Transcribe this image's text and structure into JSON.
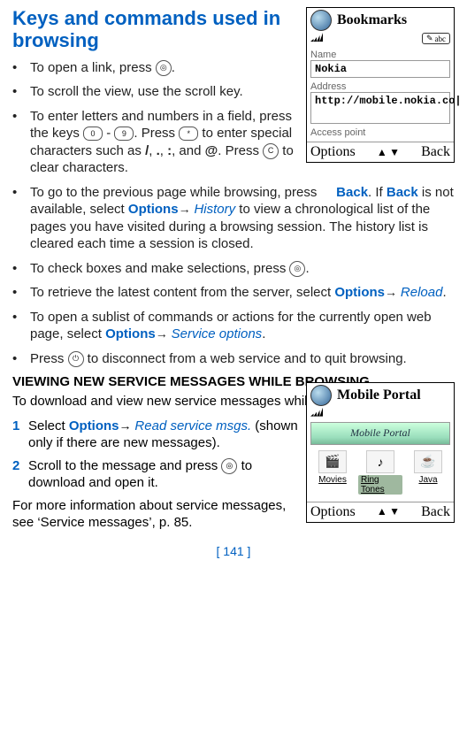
{
  "heading": "Keys and commands used in browsing",
  "bullets": [
    {
      "pre": "To open a link, press ",
      "key": "scroll",
      "post": "."
    },
    {
      "pre": "To scroll the view, use the scroll key.",
      "key": null,
      "post": ""
    },
    {
      "enter_field": true,
      "t1": "To enter letters and numbers in a field, press the keys ",
      "key0": "0",
      "dash": " - ",
      "key9": "9",
      "t2": ". Press ",
      "keystar": "*",
      "t3": " to enter special characters such as ",
      "s1": "/",
      "c1": ", ",
      "s2": ".",
      "c2": ", ",
      "s3": ":",
      "c3": ", and ",
      "s4": "@",
      "t4": ". Press ",
      "keyC": "C",
      "t5": " to clear characters."
    },
    {
      "prevpage": true,
      "t1": "To go to the previous page while browsing, press ",
      "back": "Back",
      "t2": ". If ",
      "back2": "Back",
      "t3": " is not available, select ",
      "opt": "Options",
      "arrow": "→ ",
      "hist": "History",
      "t4": " to view a chronological list of the pages you have visited during a browsing session. The history list is cleared each time a session is closed."
    },
    {
      "pre": "To check boxes and make selections, press ",
      "key": "scroll",
      "post": "."
    },
    {
      "retrieve": true,
      "t1": "To retrieve the latest content from the server, select ",
      "opt": "Options",
      "arrow": "→ ",
      "reload": "Reload",
      "t2": "."
    },
    {
      "sublist": true,
      "t1": "To open a sublist of commands or actions for the currently open web page, select ",
      "opt": "Options",
      "arrow": "→ ",
      "svc": "Service options",
      "t2": "."
    },
    {
      "pre": "Press ",
      "key": "end",
      "post": " to disconnect from a web service and to quit browsing."
    }
  ],
  "subheading": "VIEWING NEW SERVICE MESSAGES WHILE BROWSING",
  "intro": "To download and view new service messages while browsing:",
  "steps": [
    {
      "n": "1",
      "t1": "Select ",
      "opt": "Options",
      "arrow": "→ ",
      "cmd": "Read service msgs.",
      "t2": " (shown only if there are new messages)."
    },
    {
      "n": "2",
      "t1": "Scroll to the message and press ",
      "key": "scroll",
      "t2": " to download and open it."
    }
  ],
  "more": "For more information about service messages, see ‘Service messages’, p. 85.",
  "footer": "[ 141 ]",
  "phone1": {
    "title": "Bookmarks",
    "abc": "abc",
    "name_label": "Name",
    "name_value": "Nokia",
    "addr_label": "Address",
    "addr_value": "http://mobile.nokia.co|",
    "ap_label": "Access point",
    "left": "Options",
    "right": "Back",
    "mid": "▲ ▼"
  },
  "phone2": {
    "title": "Mobile Portal",
    "banner": "Mobile Portal",
    "items": [
      {
        "label": "Movies",
        "icon": "🎬"
      },
      {
        "label": "Ring Tones",
        "icon": "♪",
        "sel": true
      },
      {
        "label": "Java",
        "icon": "☕"
      }
    ],
    "left": "Options",
    "right": "Back",
    "mid": "▲ ▼"
  }
}
